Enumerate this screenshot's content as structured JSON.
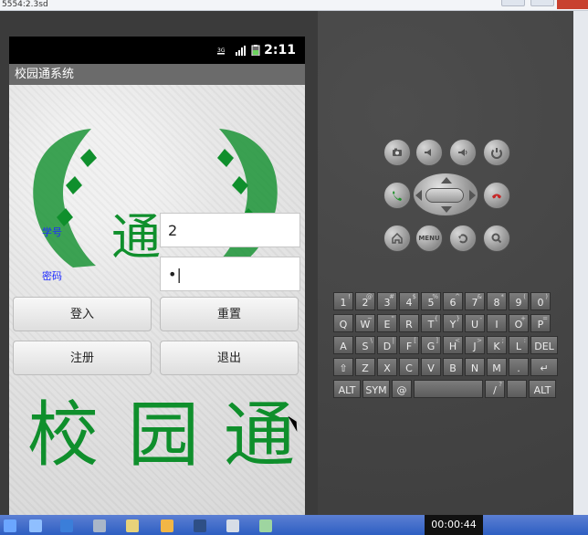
{
  "window": {
    "title": "5554:2.3sd"
  },
  "app": {
    "status_time": "2:11",
    "title": "校园通系统",
    "labels": {
      "student_id": "学号",
      "password": "密码"
    },
    "fields": {
      "student_id": "2",
      "password": "•|"
    },
    "buttons": {
      "login": "登入",
      "reset": "重置",
      "register": "注册",
      "exit": "退出"
    },
    "bg_text": {
      "top": "通",
      "left": "校",
      "middle": "园",
      "right": "通"
    }
  },
  "emulator": {
    "buttons": {
      "menu": "MENU"
    },
    "keyboard": {
      "row1": [
        "1",
        "2",
        "3",
        "4",
        "5",
        "6",
        "7",
        "8",
        "9",
        "0"
      ],
      "row1_sup": [
        "!",
        "@",
        "#",
        "$",
        "%",
        "^",
        "&",
        "*",
        "(",
        ")"
      ],
      "row2": [
        "Q",
        "W",
        "E",
        "R",
        "T",
        "Y",
        "U",
        "I",
        "O",
        "P"
      ],
      "row2_sup": [
        "",
        "~",
        "\"",
        "",
        "{",
        "}",
        "-",
        "",
        "+",
        "="
      ],
      "row3": [
        "A",
        "S",
        "D",
        "F",
        "G",
        "H",
        "J",
        "K",
        "L",
        "DEL"
      ],
      "row3_sup": [
        "",
        "\\",
        "|",
        "[",
        "]",
        "<",
        ">",
        ";",
        ":",
        ""
      ],
      "row4": [
        "⇧",
        "Z",
        "X",
        "C",
        "V",
        "B",
        "N",
        "M",
        ".",
        "↵"
      ],
      "row5": [
        "ALT",
        "SYM",
        "@",
        "",
        "/",
        "",
        "ALT"
      ],
      "row5_sup": [
        "",
        "",
        "",
        "",
        "?",
        "",
        ""
      ]
    }
  },
  "taskbar": {
    "time": "00:00:44"
  }
}
